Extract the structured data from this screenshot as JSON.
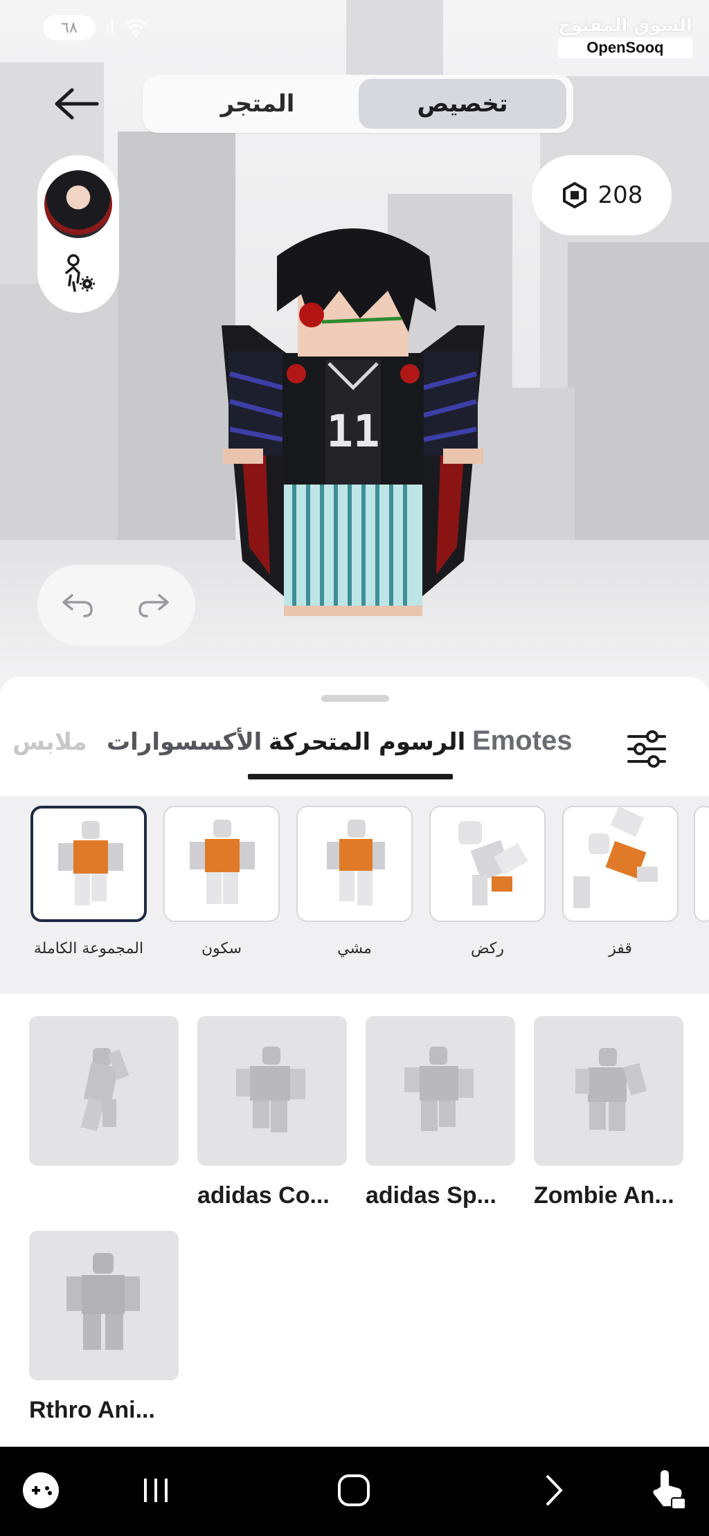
{
  "status_bar": {
    "battery": "٦٨",
    "signal_text": "ıl"
  },
  "watermark": {
    "arabic": "السوق المفتوح",
    "english": "OpenSooq"
  },
  "header": {
    "segment_store": "المتجر",
    "segment_customize": "تخصيص",
    "selected_segment": "تخصيص"
  },
  "robux": {
    "balance": "208"
  },
  "tabs": {
    "clothes": "ملابس",
    "accessories": "الأكسسوارات",
    "animations": "الرسوم المتحركة",
    "emotes": "Emotes",
    "active": "الرسوم المتحركة"
  },
  "categories": [
    {
      "label": "المجموعة الكاملة",
      "selected": true
    },
    {
      "label": "سكون",
      "selected": false
    },
    {
      "label": "مشي",
      "selected": false
    },
    {
      "label": "ركض",
      "selected": false
    },
    {
      "label": "قفز",
      "selected": false
    }
  ],
  "items": [
    {
      "label": ""
    },
    {
      "label": "adidas Co..."
    },
    {
      "label": "adidas Sp..."
    },
    {
      "label": "Zombie An..."
    },
    {
      "label": "Rthro Ani..."
    }
  ],
  "icons": {
    "back": "arrow-left-icon",
    "robux": "robux-icon",
    "avatar_settings": "avatar-settings-icon",
    "undo": "undo-icon",
    "redo": "redo-icon",
    "filter": "filter-sliders-icon"
  },
  "colors": {
    "selected_segment_bg": "#d7d8de",
    "tab_underline": "#1c1c1e",
    "selected_category_border": "#1f2a44",
    "item_bg": "#e3e3e6"
  }
}
